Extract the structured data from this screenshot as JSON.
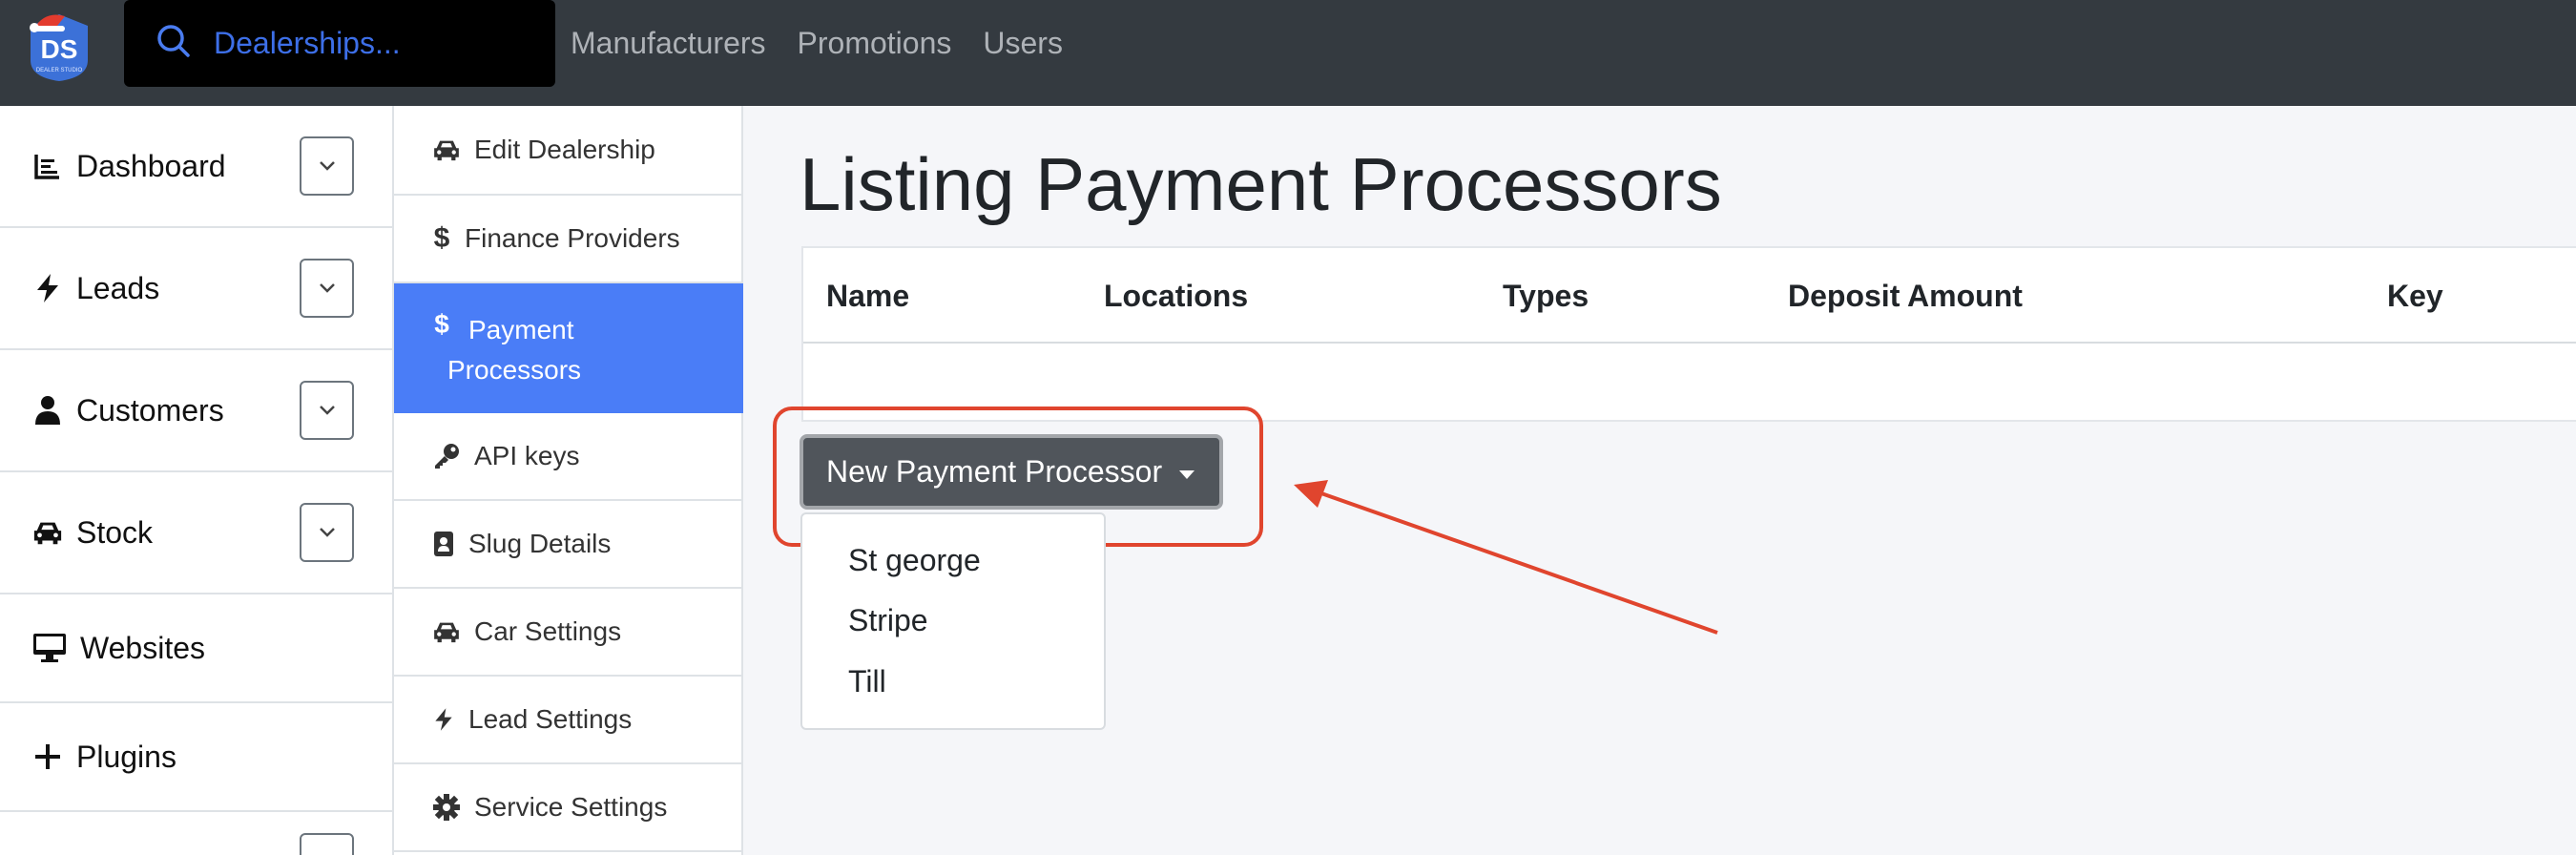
{
  "brand": {
    "logo_text": "DS",
    "logo_subtext": "DEALER STUDIO"
  },
  "search": {
    "placeholder": "Dealerships..."
  },
  "topnav": [
    "Manufacturers",
    "Promotions",
    "Users"
  ],
  "sidebar": {
    "items": [
      {
        "label": "Dashboard",
        "icon": "chart-icon",
        "expandable": true
      },
      {
        "label": "Leads",
        "icon": "bolt-icon",
        "expandable": true
      },
      {
        "label": "Customers",
        "icon": "user-icon",
        "expandable": true
      },
      {
        "label": "Stock",
        "icon": "car-icon",
        "expandable": true
      },
      {
        "label": "Websites",
        "icon": "monitor-icon",
        "expandable": false
      },
      {
        "label": "Plugins",
        "icon": "plus-icon",
        "expandable": false
      }
    ]
  },
  "subnav": {
    "items": [
      {
        "label": "Edit Dealership",
        "icon": "car-icon"
      },
      {
        "label": "Finance Providers",
        "icon": "dollar-icon"
      },
      {
        "label": "Payment Processors",
        "icon": "dollar-icon",
        "active": true
      },
      {
        "label": "API keys",
        "icon": "key-icon"
      },
      {
        "label": "Slug Details",
        "icon": "id-badge-icon"
      },
      {
        "label": "Car Settings",
        "icon": "car-icon"
      },
      {
        "label": "Lead Settings",
        "icon": "bolt-icon"
      },
      {
        "label": "Service Settings",
        "icon": "gear-icon"
      }
    ]
  },
  "main": {
    "title": "Listing Payment Processors",
    "table": {
      "columns": [
        "Name",
        "Locations",
        "Types",
        "Deposit Amount",
        "Key"
      ],
      "rows": []
    },
    "new_button_label": "New Payment Processor",
    "dropdown_options": [
      "St george",
      "Stripe",
      "Till"
    ]
  },
  "colors": {
    "navbar": "#343a40",
    "accent": "#4a7df7",
    "annotation": "#e0452e",
    "button": "#50555b"
  }
}
